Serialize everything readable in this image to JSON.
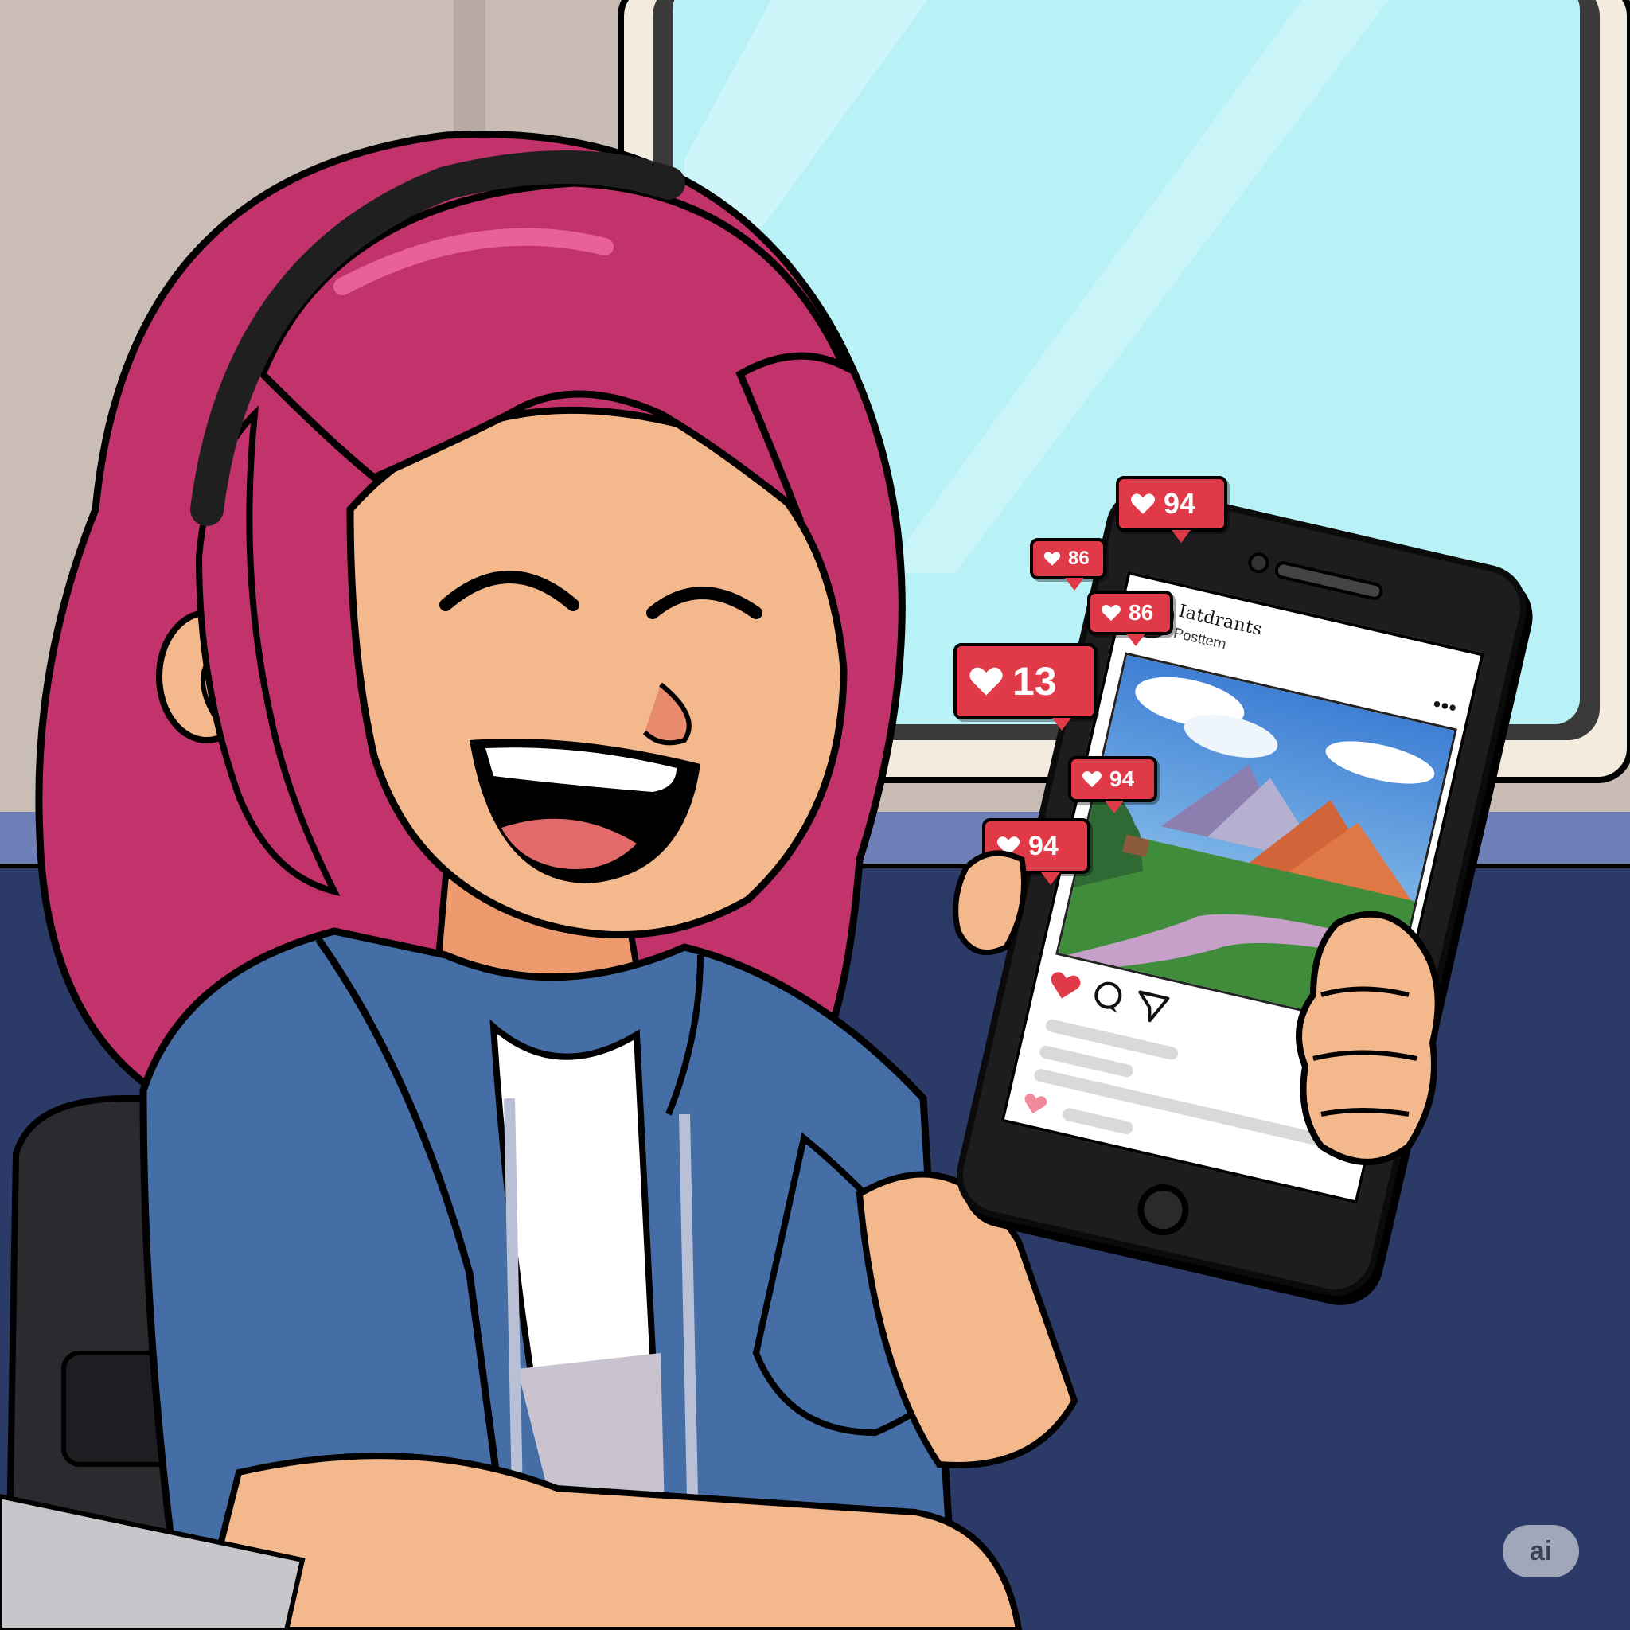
{
  "app": {
    "username": "Iatdrants",
    "subline": "Posttern",
    "more_icon": "•••"
  },
  "badges": [
    {
      "count": "94"
    },
    {
      "count": "86"
    },
    {
      "count": "86"
    },
    {
      "count": "13"
    },
    {
      "count": "94"
    },
    {
      "count": "94"
    }
  ],
  "watermark": {
    "label": "ai"
  },
  "colors": {
    "hair": "#c2336c",
    "hoodie": "#466ea6",
    "skin": "#f4b88d",
    "badge": "#e03a48",
    "sky": "#b8f1f6",
    "wall": "#2b3a66"
  },
  "icons": [
    "heart-icon",
    "comment-icon",
    "share-icon",
    "bookmark-icon",
    "more-icon"
  ]
}
